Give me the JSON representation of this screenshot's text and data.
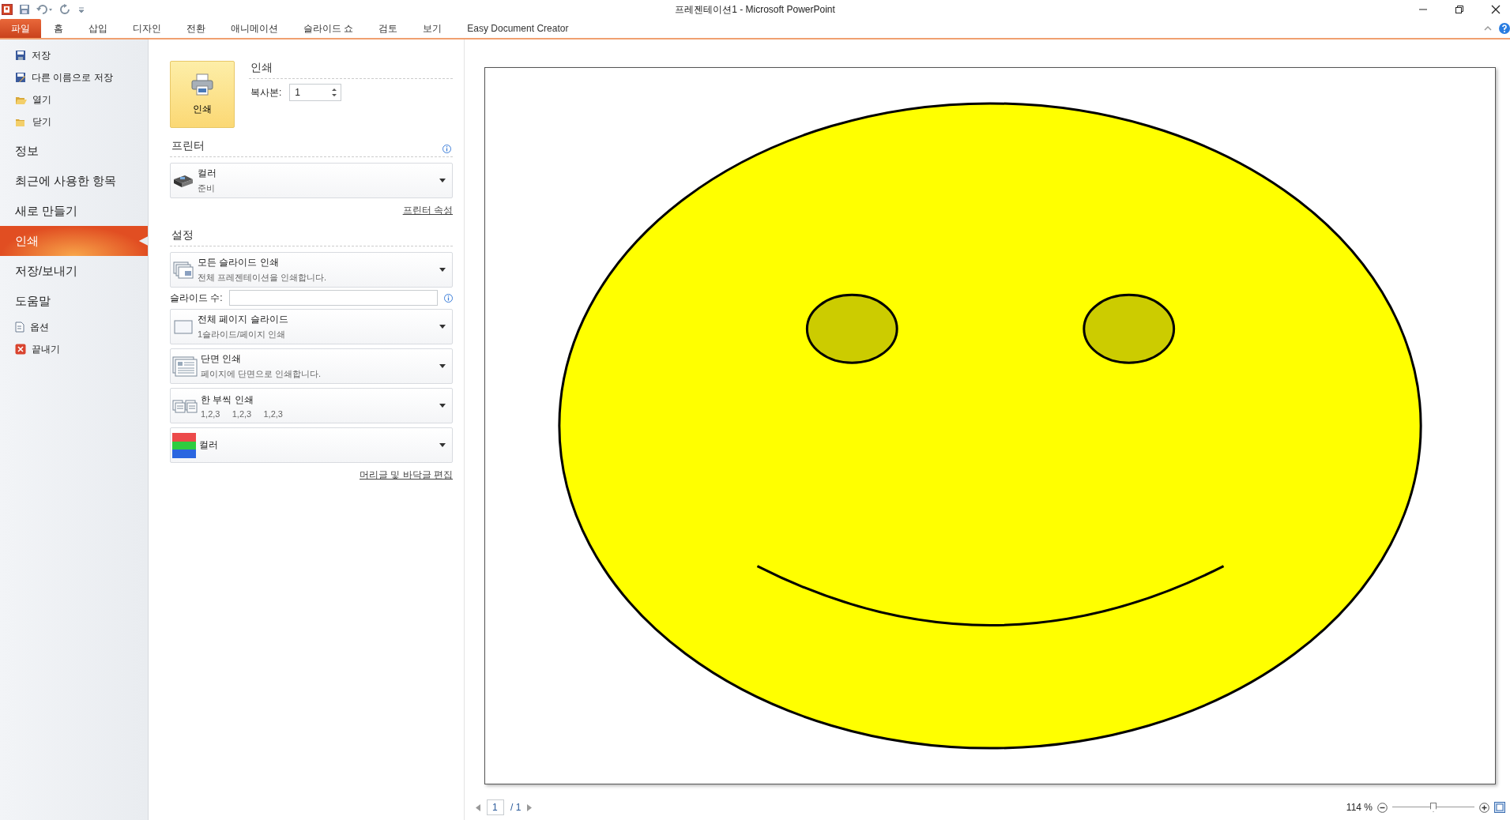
{
  "window": {
    "title": "프레젠테이션1  -  Microsoft PowerPoint"
  },
  "ribbon_tabs": [
    {
      "label": "파일",
      "selected": true
    },
    {
      "label": "홈",
      "selected": false
    },
    {
      "label": "삽입",
      "selected": false
    },
    {
      "label": "디자인",
      "selected": false
    },
    {
      "label": "전환",
      "selected": false
    },
    {
      "label": "애니메이션",
      "selected": false
    },
    {
      "label": "슬라이드 쇼",
      "selected": false
    },
    {
      "label": "검토",
      "selected": false
    },
    {
      "label": "보기",
      "selected": false
    },
    {
      "label": "Easy Document Creator",
      "selected": false
    }
  ],
  "sidebar": {
    "items": [
      {
        "kind": "command",
        "label": "저장",
        "selected": false
      },
      {
        "kind": "command",
        "label": "다른 이름으로 저장",
        "selected": false
      },
      {
        "kind": "command",
        "label": "열기",
        "selected": false
      },
      {
        "kind": "command",
        "label": "닫기",
        "selected": false
      },
      {
        "kind": "section",
        "label": "정보",
        "selected": false
      },
      {
        "kind": "section",
        "label": "최근에 사용한 항목",
        "selected": false
      },
      {
        "kind": "section",
        "label": "새로 만들기",
        "selected": false
      },
      {
        "kind": "section",
        "label": "인쇄",
        "selected": true
      },
      {
        "kind": "section",
        "label": "저장/보내기",
        "selected": false
      },
      {
        "kind": "section",
        "label": "도움말",
        "selected": false
      },
      {
        "kind": "command",
        "label": "옵션",
        "selected": false
      },
      {
        "kind": "command",
        "label": "끝내기",
        "selected": false
      }
    ]
  },
  "print": {
    "button": "인쇄",
    "heading": "인쇄",
    "copies_label": "복사본:",
    "copies": "1"
  },
  "printer": {
    "heading": "프린터",
    "name": "컬러",
    "status": "준비",
    "properties_link": "프린터 속성"
  },
  "settings": {
    "heading": "설정",
    "items": [
      {
        "kind": "dropdown",
        "title": "모든 슬라이드 인쇄",
        "subtitle": "전체 프레젠테이션을 인쇄합니다."
      },
      {
        "kind": "field",
        "label": "슬라이드 수:"
      },
      {
        "kind": "dropdown",
        "title": "전체 페이지 슬라이드",
        "subtitle": "1슬라이드/페이지 인쇄"
      },
      {
        "kind": "dropdown",
        "title": "단면 인쇄",
        "subtitle": "페이지에 단면으로 인쇄합니다."
      },
      {
        "kind": "dropdown",
        "title": "한 부씩 인쇄",
        "subtitle": "1,2,3     1,2,3     1,2,3"
      },
      {
        "kind": "dropdown",
        "title": "컬러"
      }
    ],
    "footer_link": "머리글 및 바닥글 편집"
  },
  "preview": {
    "page": "1",
    "page_total": "/ 1",
    "zoom": {
      "reading": "114 %",
      "level": 0.5
    }
  }
}
